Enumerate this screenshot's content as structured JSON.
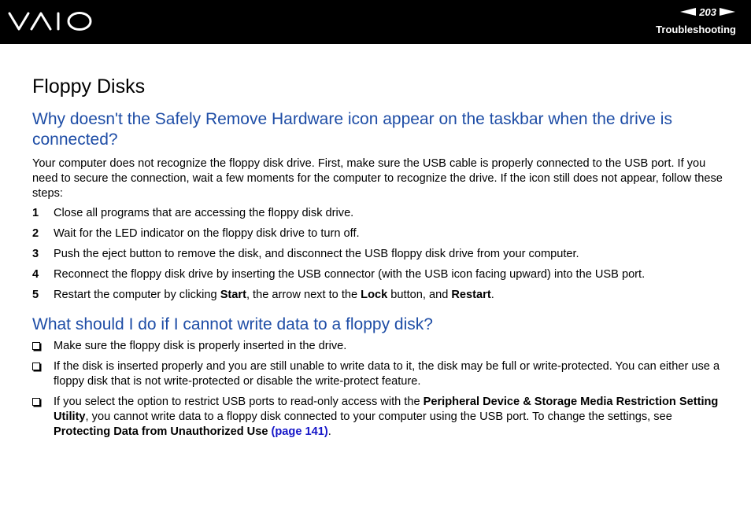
{
  "header": {
    "logo_text": "VAIO",
    "page_number": "203",
    "section": "Troubleshooting"
  },
  "page_title": "Floppy Disks",
  "q1": {
    "heading": "Why doesn't the Safely Remove Hardware icon appear on the taskbar when the drive is connected?",
    "intro": "Your computer does not recognize the floppy disk drive. First, make sure the USB cable is properly connected to the USB port. If you need to secure the connection, wait a few moments for the computer to recognize the drive. If the icon still does not appear, follow these steps:",
    "steps": [
      {
        "num": "1",
        "text": "Close all programs that are accessing the floppy disk drive."
      },
      {
        "num": "2",
        "text": "Wait for the LED indicator on the floppy disk drive to turn off."
      },
      {
        "num": "3",
        "text": "Push the eject button to remove the disk, and disconnect the USB floppy disk drive from your computer."
      },
      {
        "num": "4",
        "text": "Reconnect the floppy disk drive by inserting the USB connector (with the USB icon facing upward) into the USB port."
      },
      {
        "num": "5",
        "a": "Restart the computer by clicking ",
        "b1": "Start",
        "c": ", the arrow next to the ",
        "b2": "Lock",
        "d": " button, and ",
        "b3": "Restart",
        "e": "."
      }
    ]
  },
  "q2": {
    "heading": "What should I do if I cannot write data to a floppy disk?",
    "bullets": [
      {
        "text": "Make sure the floppy disk is properly inserted in the drive."
      },
      {
        "text": "If the disk is inserted properly and you are still unable to write data to it, the disk may be full or write-protected. You can either use a floppy disk that is not write-protected or disable the write-protect feature."
      },
      {
        "a": "If you select the option to restrict USB ports to read-only access with the ",
        "b1": "Peripheral Device & Storage Media Restriction Setting Utility",
        "c": ", you cannot write data to a floppy disk connected to your computer using the USB port. To change the settings, see ",
        "b2": "Protecting Data from Unauthorized Use",
        "space": " ",
        "link": "(page 141)",
        "e": "."
      }
    ]
  }
}
